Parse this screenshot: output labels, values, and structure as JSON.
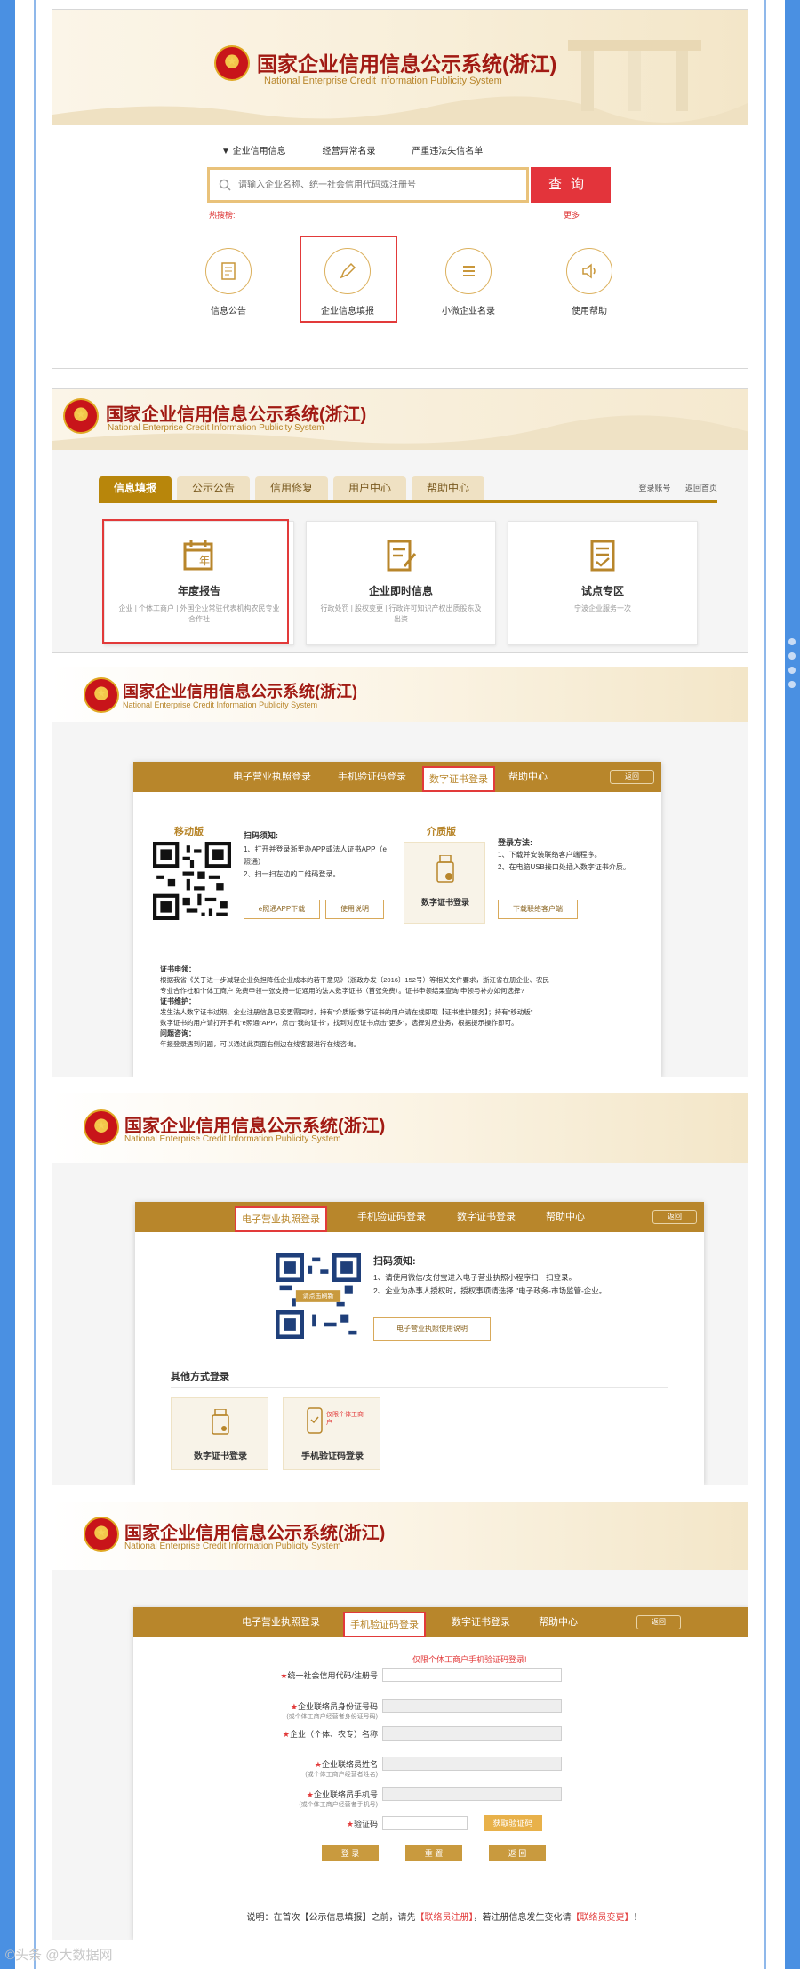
{
  "brand": {
    "title_cn": "国家企业信用信息公示系统(浙江)",
    "title_en": "National Enterprise Credit Information Publicity System"
  },
  "home": {
    "nav": [
      "▼ 企业信用信息",
      "经营异常名录",
      "严重违法失信名单"
    ],
    "search_placeholder": "请输入企业名称、统一社会信用代码或注册号",
    "search_button": "查询",
    "hint_left": "热搜榜:",
    "hint_right": "更多",
    "entries": [
      {
        "label": "信息公告",
        "icon": "notice-icon"
      },
      {
        "label": "企业信息填报",
        "icon": "pen-icon"
      },
      {
        "label": "小微企业名录",
        "icon": "list-icon"
      },
      {
        "label": "使用帮助",
        "icon": "speaker-icon"
      }
    ]
  },
  "fill": {
    "tabs": [
      "信息填报",
      "公示公告",
      "信用修复",
      "用户中心",
      "帮助中心"
    ],
    "login_link": "登录账号",
    "home_link": "返回首页",
    "cards": [
      {
        "title": "年度报告",
        "desc": "企业 | 个体工商户 | 外国企业常驻代表机构农民专业合作社"
      },
      {
        "title": "企业即时信息",
        "desc": "行政处罚 | 股权变更 | 行政许可知识产权出质股东及出资"
      },
      {
        "title": "试点专区",
        "desc": "宁波企业服务一次"
      }
    ]
  },
  "login_tabs": [
    "电子营业执照登录",
    "手机验证码登录",
    "数字证书登录",
    "帮助中心"
  ],
  "back_label": "返回",
  "cert": {
    "mobile_title": "移动版",
    "scan_title": "扫码须知:",
    "scan_lines": [
      "1、打开并登录浙里办APP或法人证书APP（e照通）",
      "2、扫一扫左边的二维码登录。"
    ],
    "btn_app": "e照通APP下载",
    "btn_help": "使用说明",
    "medium_title": "介质版",
    "medium_label": "数字证书登录",
    "login_method_title": "登录方法:",
    "login_method_lines": [
      "1、下载并安装联络客户端程序。",
      "2、在电脑USB接口处插入数字证书介质。"
    ],
    "btn_client": "下载联络客户端",
    "notes": [
      "证书申领：",
      "根据我省《关于进一步减轻企业负担降低企业成本的若干意见》（浙政办发〔2016〕152号）等相关文件要求，浙江省在册企业、农民",
      "专业合作社和个体工商户 免费申领一张支持一证通用的法人数字证书（首张免费）。证书申领结果查询  申领与补办如何选择?",
      "证书维护：",
      "发生法人数字证书过期、企业注册信息已变更需同时，持有\"介质版\"数字证书的用户请在线即取【证书维护服务】；持有\"移动版\"",
      "数字证书的用户请打开手机\"e照通\"APP，点击\"我的证书\"，找到对应证书点击\"更多\"，选择对应业务，根据提示操作即可。",
      "问题咨询：",
      "年报登录遇到问题，可以通过此页面右侧边在线客服进行在线咨询。"
    ]
  },
  "elic": {
    "qr_caption": "请点击刷新",
    "scan_title": "扫码须知:",
    "scan_lines": [
      "1、请使用微信/支付宝进入电子营业执照小程序扫一扫登录。",
      "2、企业为办事人授权时，授权事项请选择 \"电子政务-市场监管-企业。"
    ],
    "btn_guide": "电子营业执照使用说明",
    "other_title": "其他方式登录",
    "other": [
      {
        "label": "数字证书登录",
        "tag": ""
      },
      {
        "label": "手机验证码登录",
        "tag": "仅限个体工商户"
      }
    ]
  },
  "sms": {
    "notice": "仅限个体工商户手机验证码登录!",
    "fields": [
      {
        "label": "统一社会信用代码/注册号",
        "sub": "",
        "grey": false
      },
      {
        "label": "企业联络员身份证号码",
        "sub": "(或个体工商户经营者身份证号码)",
        "grey": true
      },
      {
        "label": "企业（个体、农专）名称",
        "sub": "",
        "grey": true
      },
      {
        "label": "企业联络员姓名",
        "sub": "(或个体工商户经营者姓名)",
        "grey": true
      },
      {
        "label": "企业联络员手机号",
        "sub": "(或个体工商户经营者手机号)",
        "grey": true
      },
      {
        "label": "验证码",
        "sub": "",
        "grey": false
      }
    ],
    "get_code": "获取验证码",
    "btn_login": "登 录",
    "btn_reset": "重 置",
    "btn_back": "返 回",
    "footer_parts": [
      "说明：在首次【公示信息填报】之前，请先",
      "【联络员注册】",
      "，若注册信息发生变化请",
      "【联络员变更】",
      "！"
    ]
  },
  "watermark": "©头条 @大数据网"
}
